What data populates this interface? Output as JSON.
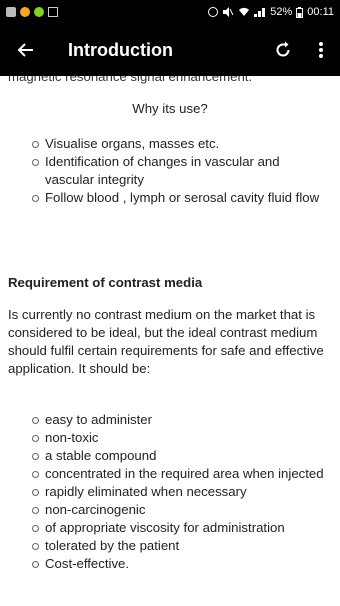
{
  "status_bar": {
    "battery": "52%",
    "time": "00:11"
  },
  "app_bar": {
    "title": "Introduction"
  },
  "content": {
    "partial_line": "magnetic resonance signal enhancement.",
    "subtitle": "Why its use?",
    "uses": [
      "Visualise organs, masses etc.",
      "Identification of changes in vascular and vascular integrity",
      "Follow blood , lymph or serosal cavity fluid flow"
    ],
    "heading": "Requirement of contrast media",
    "paragraph": " Is currently no contrast medium on the market that is considered to be ideal, but the ideal contrast medium should fulfil certain requirements for safe and effective application. It should be:",
    "requirements": [
      "easy to administer",
      "non-toxic",
      "a stable compound",
      "concentrated in the required area when injected",
      "rapidly eliminated when necessary",
      "non-carcinogenic",
      "of appropriate viscosity for administration",
      "tolerated by the patient",
      "Cost-effective."
    ]
  }
}
